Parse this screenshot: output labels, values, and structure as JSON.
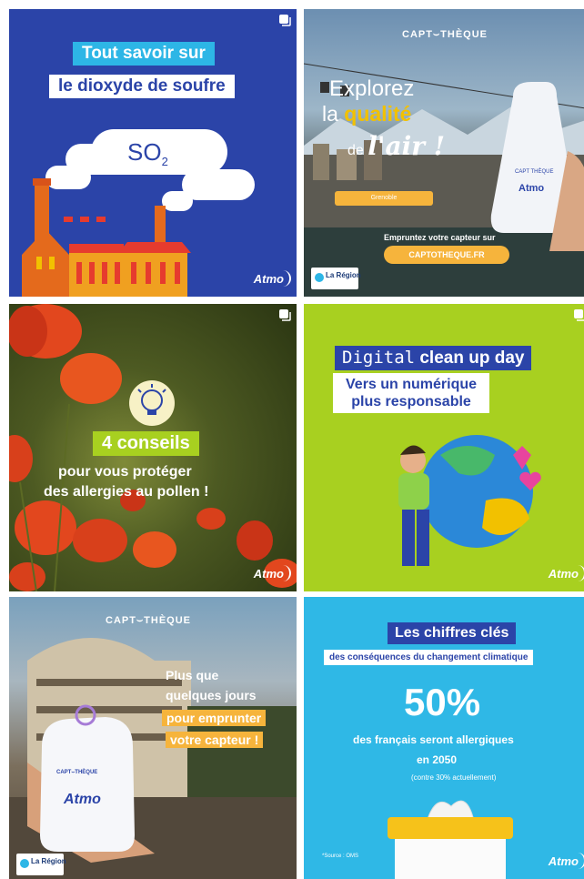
{
  "grid": {
    "posts": [
      {
        "title_line1": "Tout savoir sur",
        "title_line2": "le dioxyde de soufre",
        "formula": "SO",
        "formula_sub": "2",
        "logo": "Atmo",
        "icon": "multi-image-icon"
      },
      {
        "brand": "CAPT⌣THÈQUE",
        "line1": "Explorez",
        "line2_prefix": "la ",
        "line2_bold": "qualité",
        "line3_prefix": "de ",
        "line3_bold": "l'air !",
        "city": "Grenoble",
        "borrow": "Empruntez votre capteur sur",
        "url": "CAPTOTHEQUE.FR",
        "partner": "La Région"
      },
      {
        "number": "4 conseils",
        "line1": "pour vous protéger",
        "line2": "des allergies au pollen !",
        "logo": "Atmo",
        "icon": "multi-image-icon"
      },
      {
        "line1_word": "Digital",
        "line1_rest": " clean up day",
        "line2a": "Vers un numérique",
        "line2b": "plus responsable",
        "logo": "Atmo",
        "icon": "multi-image-icon"
      },
      {
        "brand": "CAPT⌣THÈQUE",
        "line1": "Plus que",
        "line2": "quelques jours",
        "line3": "pour emprunter",
        "line4": "votre capteur !",
        "device_brand": "CAPT⌣THÈQUE",
        "device_logo": "Atmo",
        "partner": "La Région"
      },
      {
        "title": "Les chiffres clés",
        "subtitle": "des conséquences du changement climatique",
        "percent": "50%",
        "desc1": "des français seront allergiques",
        "desc2": "en 2050",
        "note": "(contre 30% actuellement)",
        "source": "*Source : OMS",
        "logo": "Atmo"
      }
    ]
  },
  "colors": {
    "navy": "#2b44a8",
    "cyan": "#2db6e6",
    "lime": "#a8d020",
    "orange": "#f6b43c",
    "red": "#e63b2e"
  }
}
